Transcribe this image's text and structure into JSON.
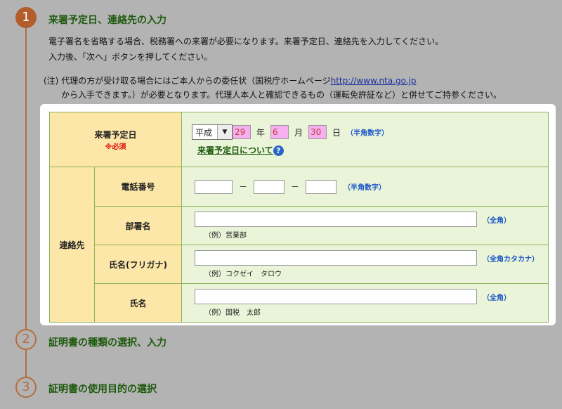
{
  "steps": [
    {
      "number": "1",
      "title": "来署予定日、連絡先の入力"
    },
    {
      "number": "2",
      "title": "証明書の種類の選択、入力"
    },
    {
      "number": "3",
      "title": "証明書の使用目的の選択"
    }
  ],
  "description": {
    "line1": "電子署名を省略する場合、税務署への来署が必要になります。来署予定日、連絡先を入力してください。",
    "line2": "入力後、「次へ」ボタンを押してください。"
  },
  "note": {
    "prefix": "(注)",
    "line1_text": "代理の方が受け取る場合にはご本人からの委任状（国税庁ホームページ",
    "link": "http://www.nta.go.jp",
    "line2": "から入手できます。）が必要となります。代理人本人と確認できるもの（運転免許証など）と併せてご持参ください。"
  },
  "form": {
    "visit_date": {
      "label": "来署予定日",
      "required": "※必須",
      "era": "平成",
      "era_arrow": "▼",
      "year": "29",
      "year_unit": "年",
      "month": "6",
      "month_unit": "月",
      "day": "30",
      "day_unit": "日",
      "hint": "（半角数字）",
      "help_link": "来署予定日について",
      "help_icon": "?"
    },
    "contact_label": "連絡先",
    "phone": {
      "label": "電話番号",
      "part1": "",
      "part2": "",
      "part3": "",
      "separator": "－",
      "hint": "（半角数字）"
    },
    "dept": {
      "label": "部署名",
      "value": "",
      "hint": "（全角）",
      "example": "（例）営業部"
    },
    "kana": {
      "label": "氏名(フリガナ)",
      "value": "",
      "hint": "（全角カタカナ）",
      "example": "（例）コクゼイ　タロウ"
    },
    "name": {
      "label": "氏名",
      "value": "",
      "hint": "（全角）",
      "example": "（例）国税　太郎"
    }
  }
}
